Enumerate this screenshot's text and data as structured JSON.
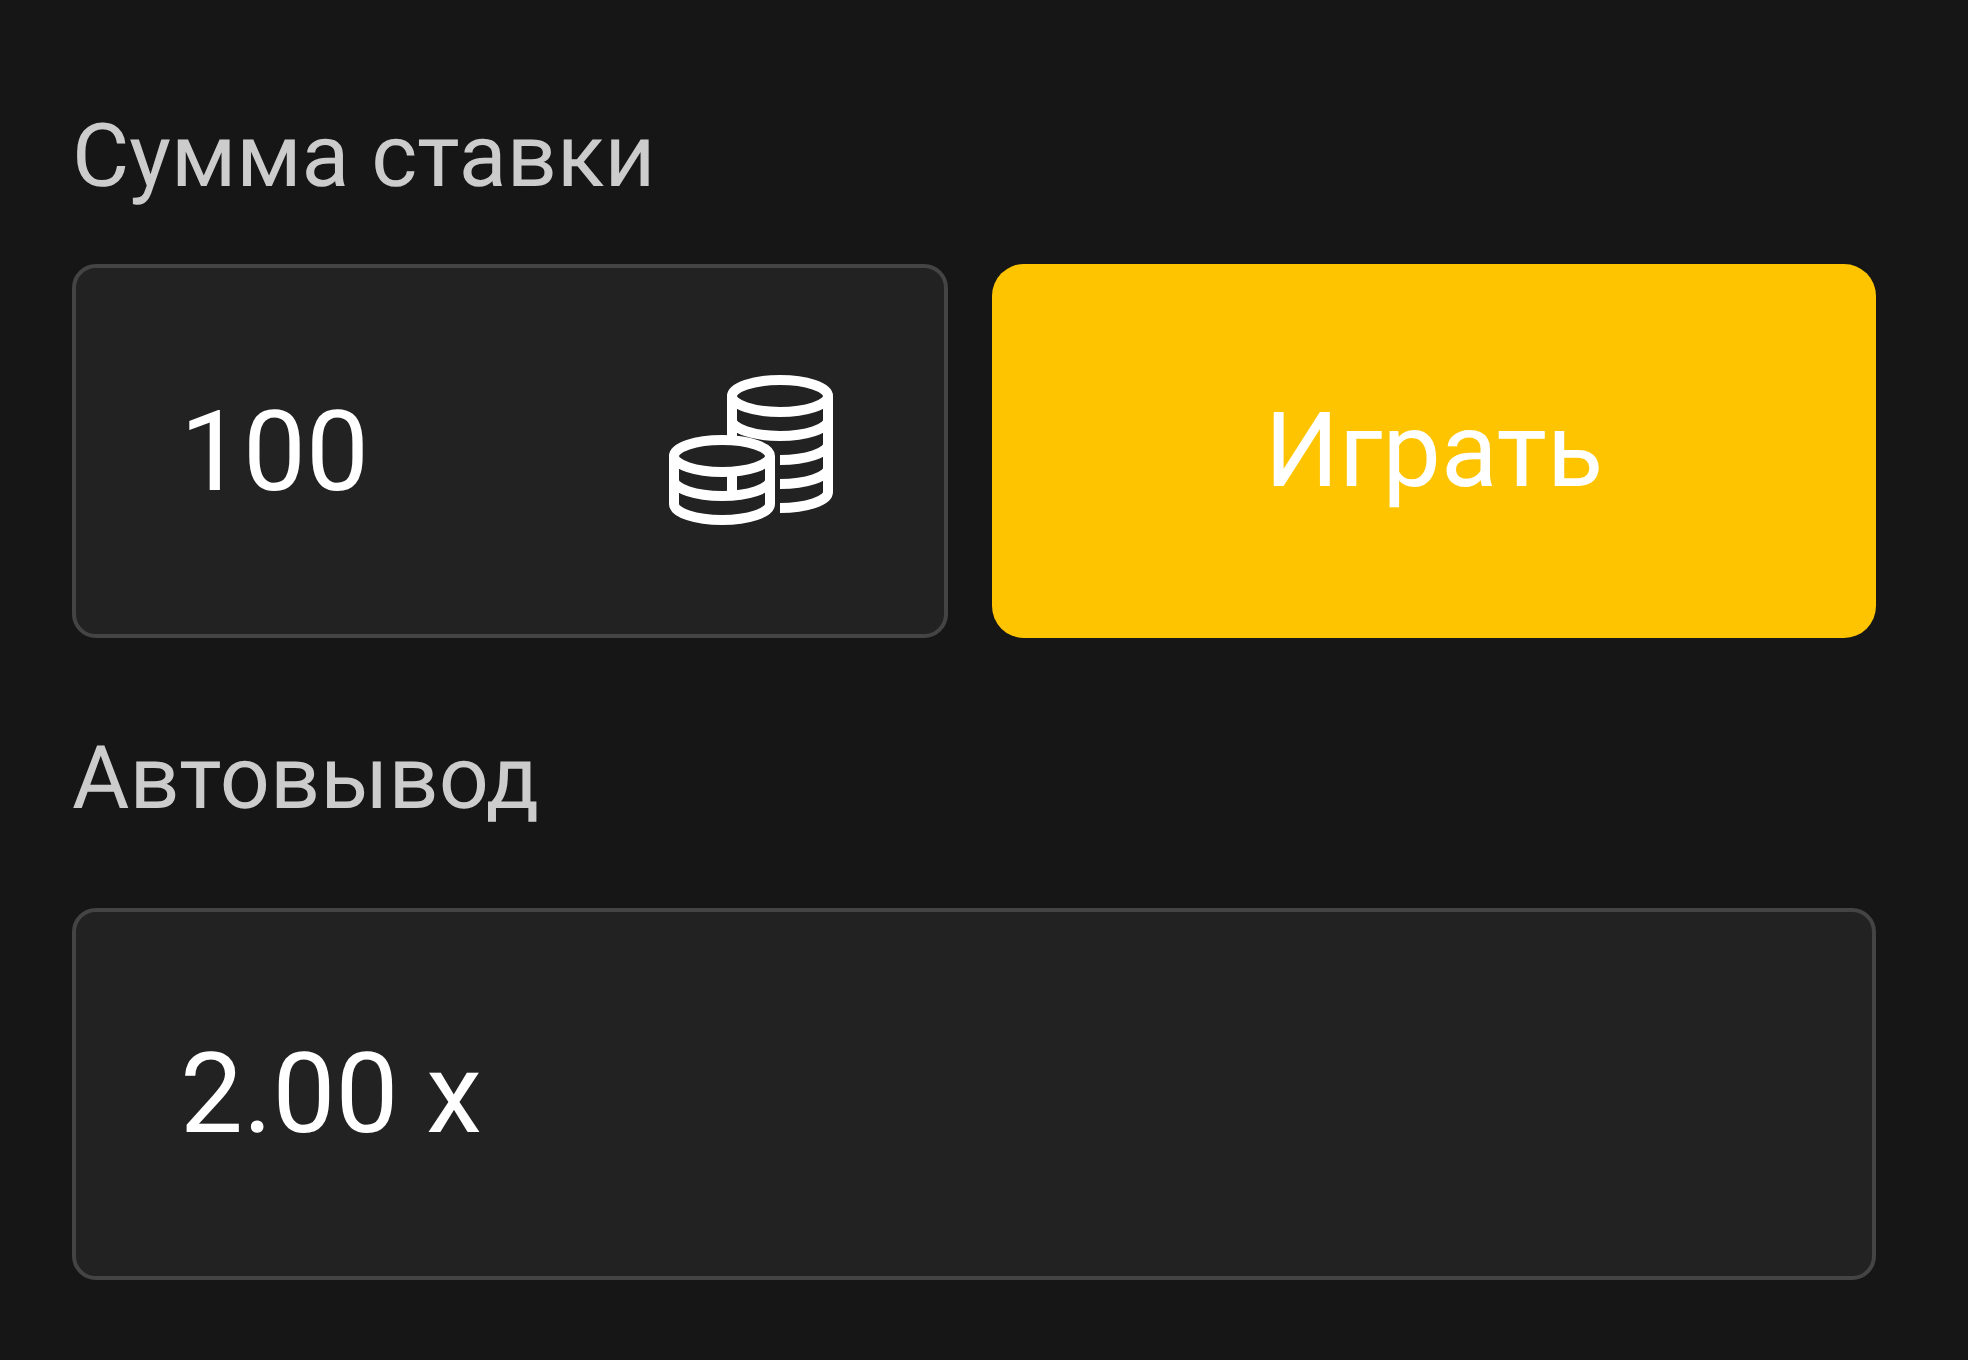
{
  "bet": {
    "label": "Сумма ставки",
    "value": "100"
  },
  "play_button": {
    "label": "Играть"
  },
  "autocashout": {
    "label": "Автовывод",
    "value": "2.00 x"
  }
}
